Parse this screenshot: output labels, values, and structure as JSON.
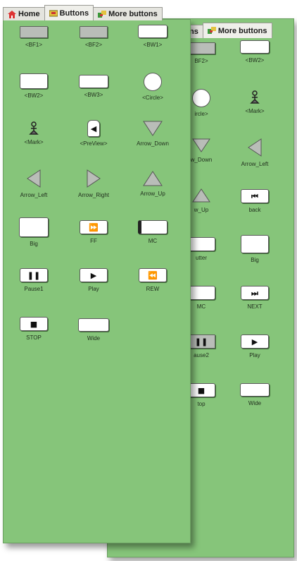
{
  "tabs": {
    "home": "Home",
    "buttons": "Buttons",
    "more_buttons": "More buttons"
  },
  "back_tabs": {
    "buttons_partial": "ns",
    "more_buttons": "More buttons"
  },
  "front_buttons": [
    {
      "label": "<BF1>"
    },
    {
      "label": "<BF2>"
    },
    {
      "label": "<BW1>"
    },
    {
      "label": "<BW2>"
    },
    {
      "label": "<BW3>"
    },
    {
      "label": "<Circle>"
    },
    {
      "label": "<Mark>"
    },
    {
      "label": "<PreView>"
    },
    {
      "label": "Arrow_Down"
    },
    {
      "label": "Arrow_Left"
    },
    {
      "label": "Arrow_Right"
    },
    {
      "label": "Arrow_Up"
    },
    {
      "label": "Big"
    },
    {
      "label": "FF"
    },
    {
      "label": "MC"
    },
    {
      "label": "Pause1"
    },
    {
      "label": "Play"
    },
    {
      "label": "REW"
    },
    {
      "label": "STOP"
    },
    {
      "label": "Wide"
    }
  ],
  "back_buttons": [
    {
      "label": "BF2>"
    },
    {
      "label": "<BW2>"
    },
    {
      "label": "ircle>"
    },
    {
      "label": "<Mark>"
    },
    {
      "label": "w_Down"
    },
    {
      "label": "Arrow_Left"
    },
    {
      "label": "w_Up"
    },
    {
      "label": "back"
    },
    {
      "label": "utter"
    },
    {
      "label": "Big"
    },
    {
      "label": "MC"
    },
    {
      "label": "NEXT"
    },
    {
      "label": "ause2"
    },
    {
      "label": "Play"
    },
    {
      "label": "top"
    },
    {
      "label": "Wide"
    }
  ],
  "colors": {
    "panel": "#86c57a",
    "tab": "#e4e4de",
    "button_face": "#ffffff",
    "gray_button": "#b9bdb8"
  },
  "icons": {
    "home_tab": "house-icon",
    "buttons_tab": "buttons-icon",
    "more_buttons_tab": "more-buttons-icon"
  }
}
